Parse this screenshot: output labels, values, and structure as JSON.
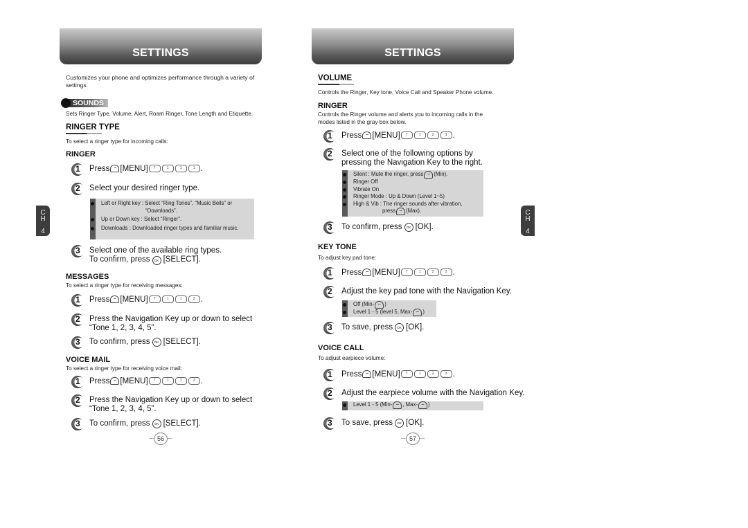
{
  "left_page": {
    "banner_title": "SETTINGS",
    "intro": "Customizes your phone and optimizes performance through a variety of settings.",
    "section_tag": "SOUNDS",
    "section_desc": "Sets Ringer Type, Volume, Alert, Roam Ringer, Tone Length and Etiquette.",
    "heading": "RINGER TYPE",
    "heading_desc": "To select a ringer type for incoming calls:",
    "ringer": {
      "title": "RINGER",
      "step1": {
        "num": "1",
        "press": "Press",
        "menu": "[MENU]",
        "keys": [
          "7",
          "1",
          "1",
          "1"
        ]
      },
      "step2": {
        "num": "2",
        "text": "Select your desired ringer type."
      },
      "box": [
        "Left or Right key : Select “Ring Tones”, “Music Bells” or",
        "“Downloads”.",
        "Up or Down key : Select “Ringer”.",
        "Downloads : Downloaded ringer types and familiar music."
      ],
      "step3": {
        "num": "3",
        "line1": "Select one of the available ring types.",
        "line2_pre": "To confirm, press",
        "line2_post": "[SELECT]."
      }
    },
    "messages": {
      "title": "MESSAGES",
      "desc": "To select a ringer type for receiving messages:",
      "step1": {
        "num": "1",
        "press": "Press",
        "menu": "[MENU]",
        "keys": [
          "7",
          "1",
          "1",
          "2"
        ]
      },
      "step2": {
        "num": "2",
        "line1": "Press the Navigation Key up or down to select",
        "line2": "“Tone 1, 2, 3, 4, 5”."
      },
      "step3": {
        "num": "3",
        "pre": "To confirm, press",
        "post": "[SELECT]."
      }
    },
    "voice_mail": {
      "title": "VOICE MAIL",
      "desc": "To select a ringer type for receiving voice mail:",
      "step1": {
        "num": "1",
        "press": "Press",
        "menu": "[MENU]",
        "keys": [
          "7",
          "1",
          "1",
          "3"
        ]
      },
      "step2": {
        "num": "2",
        "line1": "Press the Navigation Key up or down to select",
        "line2": "“Tone 1, 2, 3, 4, 5”."
      },
      "step3": {
        "num": "3",
        "pre": "To confirm, press",
        "post": "[SELECT]."
      }
    },
    "page_number": "56",
    "chapter_tab": {
      "ch": "C H",
      "c": "C",
      "h": "H",
      "n": "4"
    }
  },
  "right_page": {
    "banner_title": "SETTINGS",
    "heading": "VOLUME",
    "heading_desc": "Controls the Ringer, Key tone, Voice Call and Speaker Phone volume.",
    "ringer": {
      "title": "RINGER",
      "desc1": "Controls the Ringer volume and alerts you to incoming calls in the",
      "desc2": "modes listed in the gray box below.",
      "step1": {
        "num": "1",
        "press": "Press",
        "menu": "[MENU]",
        "keys": [
          "7",
          "1",
          "2",
          "1"
        ]
      },
      "step2": {
        "num": "2",
        "line1": "Select one of the following options by",
        "line2": "pressing the Navigation Key to the right."
      },
      "box": {
        "silent_pre": "Silent : Mute the ringer, press",
        "silent_post": "(Min).",
        "ringer_off": "Ringer Off",
        "vibrate_on": "Vibrate On",
        "ringer_mode": "Ringer Mode : Up & Down (Level 1~5)",
        "high_vib": "High & Vib : The ringer sounds after vibration,",
        "press_pre": "press",
        "press_post": "(Max)."
      },
      "step3": {
        "num": "3",
        "pre": "To confirm, press",
        "post": "[OK]."
      }
    },
    "key_tone": {
      "title": "KEY TONE",
      "desc": "To adjust key pad tone:",
      "step1": {
        "num": "1",
        "press": "Press",
        "menu": "[MENU]",
        "keys": [
          "7",
          "1",
          "2",
          "2"
        ]
      },
      "step2": {
        "num": "2",
        "text": "Adjust the key pad tone with the Navigation Key."
      },
      "box": {
        "off_pre": "Off (Min-",
        "off_post": ")",
        "level_pre": "Level 1 - 5 (level 5, Max-",
        "level_post": ")"
      },
      "step3": {
        "num": "3",
        "pre": "To save, press",
        "post": "[OK]."
      }
    },
    "voice_call": {
      "title": "VOICE CALL",
      "desc": "To adjust earpiece volume:",
      "step1": {
        "num": "1",
        "press": "Press",
        "menu": "[MENU]",
        "keys": [
          "7",
          "1",
          "2",
          "3"
        ]
      },
      "step2": {
        "num": "2",
        "text": "Adjust the earpiece volume with the Navigation Key."
      },
      "box": {
        "pre": "Level 1 - 5 (Min-",
        "mid": ", Max-",
        "post": ")"
      },
      "step3": {
        "num": "3",
        "pre": "To save, press",
        "post": "[OK]."
      }
    },
    "page_number": "57",
    "chapter_tab": {
      "c": "C",
      "h": "H",
      "n": "4"
    }
  },
  "icons": {
    "soft_left": "−",
    "soft_right": "−",
    "ok": "OK"
  }
}
